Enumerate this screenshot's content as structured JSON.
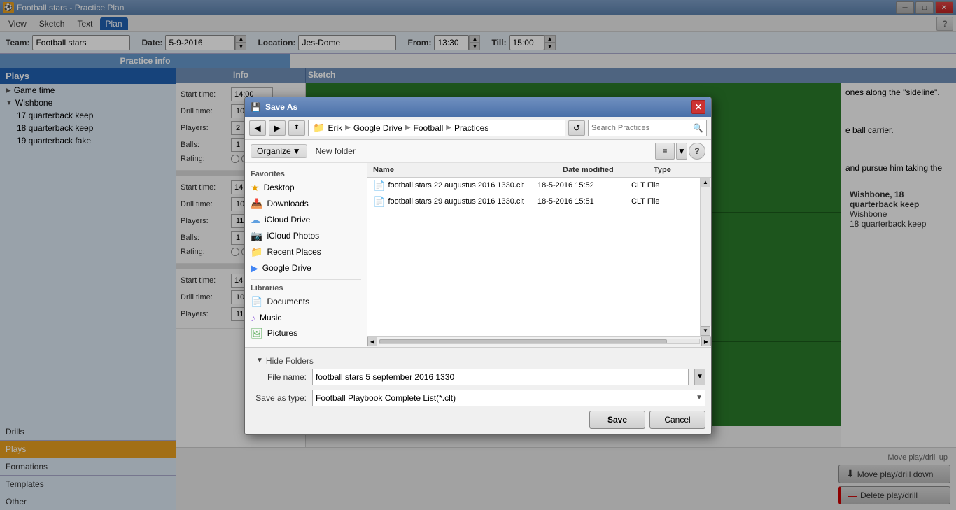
{
  "app": {
    "title": "Football stars - Practice Plan",
    "title_icon": "⚽"
  },
  "titlebar": {
    "buttons": [
      "─",
      "□",
      "✕"
    ]
  },
  "menu": {
    "items": [
      "View",
      "Sketch",
      "Text",
      "Plan"
    ],
    "active": "Plan"
  },
  "form": {
    "team_label": "Team:",
    "team_value": "Football stars",
    "date_label": "Date:",
    "date_value": "5-9-2016",
    "location_label": "Location:",
    "location_value": "Jes-Dome",
    "from_label": "From:",
    "from_value": "13:30",
    "till_label": "Till:",
    "till_value": "15:00"
  },
  "practice_info_btn": "Practice info",
  "sidebar": {
    "header": "Plays",
    "items": [
      {
        "id": "game-time",
        "label": "Game time",
        "level": 0,
        "arrow": "▶"
      },
      {
        "id": "wishbone",
        "label": "Wishbone",
        "level": 0,
        "arrow": "▼",
        "selected": false
      },
      {
        "id": "qb-keep-17",
        "label": "17 quarterback keep",
        "level": 1
      },
      {
        "id": "qb-keep-18",
        "label": "18 quarterback keep",
        "level": 1
      },
      {
        "id": "qb-fake-19",
        "label": "19 quarterback fake",
        "level": 1
      }
    ],
    "footer": [
      {
        "id": "drills",
        "label": "Drills",
        "active": false
      },
      {
        "id": "plays",
        "label": "Plays",
        "active": true
      },
      {
        "id": "formations",
        "label": "Formations",
        "active": false
      },
      {
        "id": "templates",
        "label": "Templates",
        "active": false
      },
      {
        "id": "other",
        "label": "Other",
        "active": false
      }
    ]
  },
  "info_panel": {
    "header": "Info",
    "sections": [
      {
        "start_time_label": "Start time:",
        "start_time_value": "14:00",
        "drill_time_label": "Drill time:",
        "drill_time_value": "10 min",
        "players_label": "Players:",
        "players_value": "2",
        "balls_label": "Balls:",
        "balls_value": "1",
        "rating_label": "Rating:",
        "rating_dots": [
          false,
          false,
          false,
          false,
          false,
          true
        ]
      },
      {
        "start_time_label": "Start time:",
        "start_time_value": "14:10",
        "drill_time_label": "Drill time:",
        "drill_time_value": "10 min",
        "players_label": "Players:",
        "players_value": "11",
        "balls_label": "Balls:",
        "balls_value": "1",
        "rating_label": "Rating:",
        "rating_dots": [
          false,
          false,
          true,
          false,
          false,
          false
        ]
      },
      {
        "start_time_label": "Start time:",
        "start_time_value": "14:20",
        "drill_time_label": "Drill time:",
        "drill_time_value": "10 min",
        "players_label": "Players:",
        "players_value": "11",
        "balls_label": "Balls:",
        "balls_value": ""
      }
    ]
  },
  "sketch_header": "Sketch",
  "right_panel": {
    "description_title": "Wishbone, 18 quarterback keep",
    "description_sub1": "Wishbone",
    "description_sub2": "18 quarterback keep",
    "text1": "ones along the \"sideline\".",
    "text2": "e ball carrier.",
    "text3": "and pursue him taking the"
  },
  "bottom_buttons": {
    "move_up": "Move play/drill up",
    "move_down": "Move play/drill down",
    "delete": "Delete play/drill"
  },
  "dialog": {
    "title": "Save As",
    "nav": {
      "back_btn": "◀",
      "forward_btn": "▶",
      "breadcrumbs": [
        "Erik",
        "Google Drive",
        "Football",
        "Practices"
      ],
      "search_placeholder": "Search Practices"
    },
    "toolbar": {
      "organize_label": "Organize",
      "new_folder_label": "New folder"
    },
    "sidebar": {
      "favorites_header": "Favorites",
      "items": [
        {
          "icon": "★",
          "icon_class": "star",
          "label": "Desktop"
        },
        {
          "icon": "📥",
          "icon_class": "folder",
          "label": "Downloads"
        },
        {
          "icon": "☁",
          "icon_class": "cloud",
          "label": "iCloud Drive"
        },
        {
          "icon": "📷",
          "icon_class": "cloud",
          "label": "iCloud Photos"
        },
        {
          "icon": "📁",
          "icon_class": "recent",
          "label": "Recent Places"
        },
        {
          "icon": "▶",
          "icon_class": "folder",
          "label": "Google Drive"
        }
      ],
      "libraries_header": "Libraries",
      "library_items": [
        {
          "icon": "📚",
          "icon_class": "folder",
          "label": "Documents"
        },
        {
          "icon": "♪",
          "icon_class": "folder",
          "label": "Music"
        },
        {
          "icon": "🖼",
          "icon_class": "folder",
          "label": "Pictures"
        }
      ]
    },
    "file_list": {
      "columns": [
        "Name",
        "Date modified",
        "Type"
      ],
      "files": [
        {
          "name": "football stars 22 augustus 2016 1330.clt",
          "date": "18-5-2016 15:52",
          "type": "CLT File"
        },
        {
          "name": "football stars 29 augustus 2016 1330.clt",
          "date": "18-5-2016 15:51",
          "type": "CLT File"
        }
      ]
    },
    "footer": {
      "filename_label": "File name:",
      "filename_value": "football stars 5 september 2016 1330",
      "savetype_label": "Save as type:",
      "savetype_value": "Football Playbook Complete List(*.clt)",
      "save_btn": "Save",
      "cancel_btn": "Cancel",
      "hide_folders": "Hide Folders"
    }
  }
}
